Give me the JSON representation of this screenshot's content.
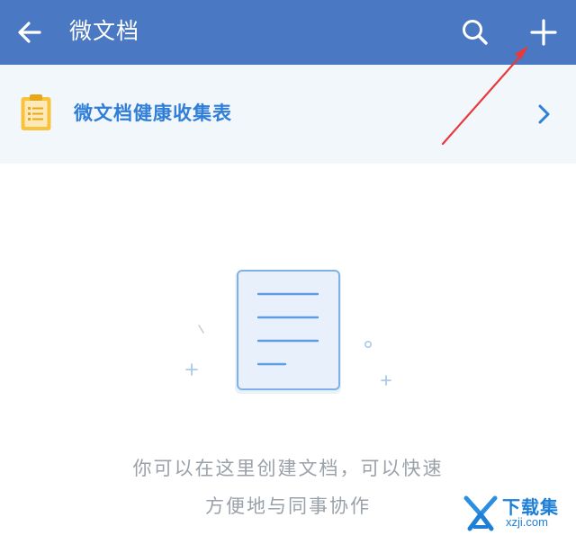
{
  "header": {
    "title": "微文档",
    "back_icon": "back-arrow-icon",
    "search_icon": "search-icon",
    "add_icon": "plus-icon",
    "background": "#4a78c2"
  },
  "banner": {
    "icon": "clipboard-list-icon",
    "label": "微文档健康收集表",
    "chevron_icon": "chevron-right-icon",
    "background": "#f2f7fc",
    "label_color": "#2f7ed8"
  },
  "empty_state": {
    "illustration_icon": "document-illustration-icon",
    "line1": "你可以在这里创建文档，可以快速",
    "line2": "方便地与同事协作"
  },
  "annotation": {
    "icon": "red-arrow-annotation",
    "color": "#e8393b"
  },
  "watermark": {
    "logo_icon": "xzji-logo-icon",
    "text": "下载集",
    "sub": "xzji.com"
  }
}
